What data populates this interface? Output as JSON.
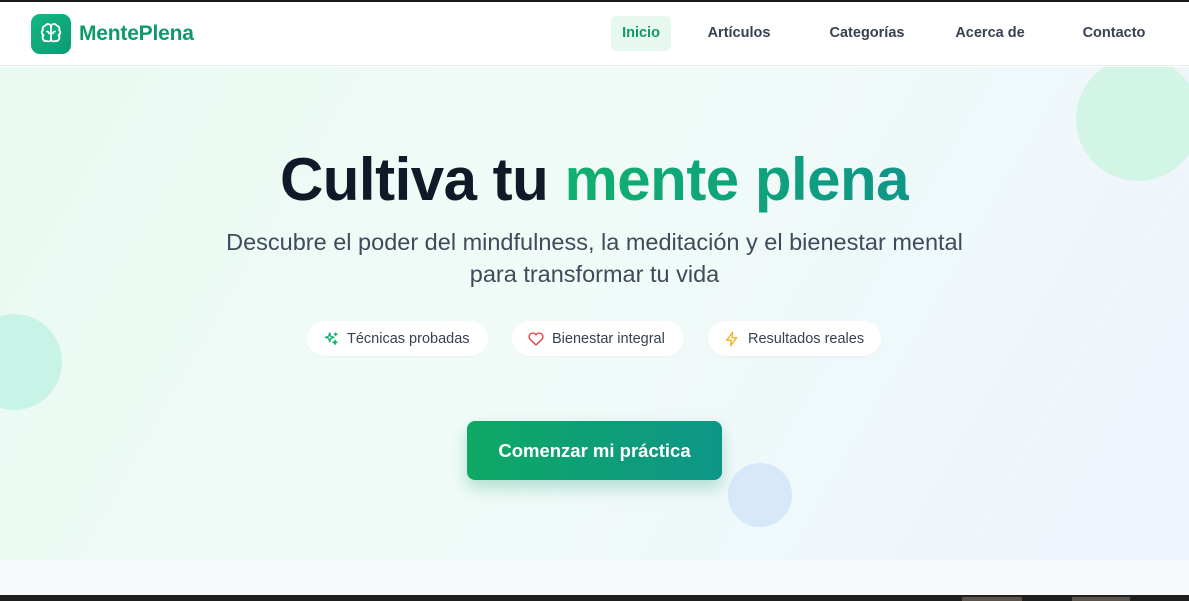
{
  "brand": {
    "name": "MentePlena",
    "logo_icon": "brain-icon"
  },
  "nav": {
    "items": [
      {
        "label": "Inicio",
        "active": true
      },
      {
        "label": "Artículos",
        "active": false
      },
      {
        "label": "Categorías",
        "active": false
      },
      {
        "label": "Acerca de",
        "active": false
      },
      {
        "label": "Contacto",
        "active": false
      }
    ]
  },
  "hero": {
    "title_plain": "Cultiva tu ",
    "title_accent": "mente plena",
    "subtitle": "Descubre el poder del mindfulness, la meditación y el bienestar mental para transformar tu vida",
    "chips": [
      {
        "label": "Técnicas probadas",
        "icon": "sparkles-icon"
      },
      {
        "label": "Bienestar integral",
        "icon": "heart-icon"
      },
      {
        "label": "Resultados reales",
        "icon": "lightning-icon"
      }
    ],
    "cta_label": "Comenzar mi práctica"
  },
  "colors": {
    "brand_green": "#0f9a6a",
    "accent_gradient_start": "#10b06e",
    "accent_gradient_end": "#0f9688",
    "heart_red": "#e23b3b",
    "lightning_amber": "#f0b429"
  }
}
